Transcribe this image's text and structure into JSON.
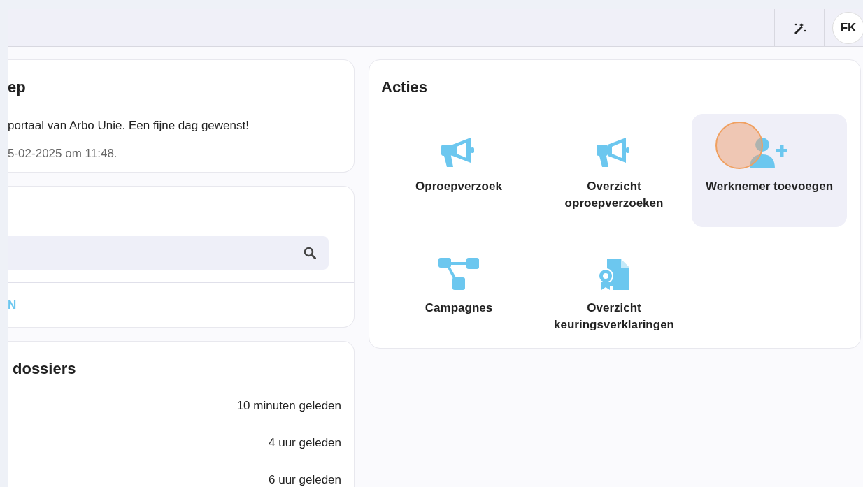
{
  "topbar": {
    "avatar": "FK"
  },
  "welcome": {
    "title": "ep",
    "message": "portaal van Arbo Unie. Een fijne dag gewenst!",
    "last_login": "5-02-2025 om 11:48."
  },
  "search_card": {
    "link": "N"
  },
  "dossiers": {
    "title": "dossiers",
    "rows": [
      {
        "time": "10 minuten geleden"
      },
      {
        "time": "4 uur geleden"
      },
      {
        "time": "6 uur geleden"
      }
    ]
  },
  "actions": {
    "title": "Acties",
    "items": [
      {
        "kind": "megaphone",
        "label": "Oproepverzoek",
        "hovered": false
      },
      {
        "kind": "megaphone",
        "label": "Overzicht oproepverzoeken",
        "hovered": false
      },
      {
        "kind": "user-plus",
        "label": "Werknemer toevoegen",
        "hovered": true
      },
      {
        "kind": "flow",
        "label": "Campagnes",
        "hovered": false
      },
      {
        "kind": "certificate",
        "label": "Overzicht keuringsverklaringen",
        "hovered": false
      }
    ]
  }
}
